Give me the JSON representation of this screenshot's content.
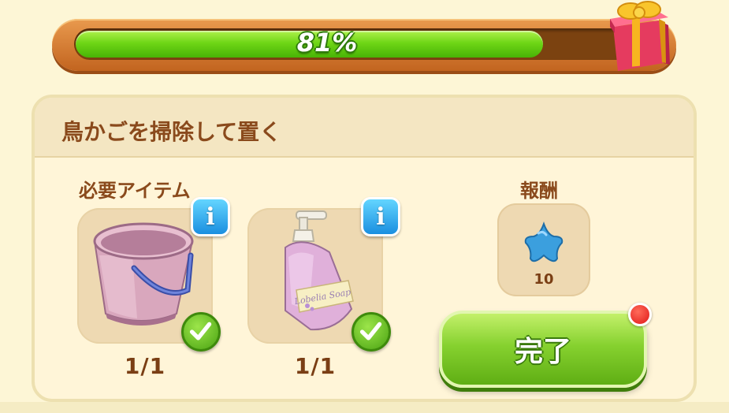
{
  "progress": {
    "percent_label": "81%",
    "value": 0.81
  },
  "task": {
    "title": "鳥かごを掃除して置く"
  },
  "required": {
    "label": "必要アイテム",
    "items": [
      {
        "icon": "bucket-icon",
        "count": "1/1",
        "info": "i"
      },
      {
        "icon": "soap-bottle-icon",
        "count": "1/1",
        "info": "i"
      }
    ]
  },
  "reward": {
    "label": "報酬",
    "icon": "blue-star-icon",
    "amount": "10"
  },
  "actions": {
    "complete_label": "完了"
  },
  "colors": {
    "progress_green": "#6fd616",
    "frame_orange": "#d97d34",
    "title_brown": "#8a4a1c",
    "info_blue": "#1a8fe0",
    "button_green": "#86d12f",
    "notify_red": "#e01818"
  }
}
